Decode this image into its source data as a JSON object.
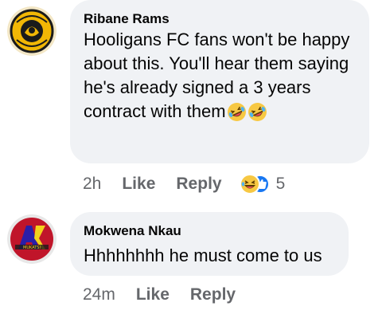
{
  "comments": [
    {
      "author": "Ribane Rams",
      "avatar_badge": "KAIZER CHIEFS",
      "text": "Hooligans FC fans won't be happy about this. You'll hear them saying he's already signed a 3 years contract with them",
      "emojis": [
        "rolling-on-floor-laughing-emoji",
        "rolling-on-floor-laughing-emoji"
      ],
      "time": "2h",
      "like_label": "Like",
      "reply_label": "Reply",
      "reactions": [
        "haha-reaction-icon",
        "like-reaction-icon"
      ],
      "reaction_count": "5"
    },
    {
      "author": "Mokwena Nkau",
      "text": "Hhhhhhhh he must come to us",
      "time": "24m",
      "like_label": "Like",
      "reply_label": "Reply"
    }
  ],
  "colors": {
    "bubble": "#f0f2f5",
    "meta_text": "#65676b",
    "like_blue": "#1877f2",
    "emoji_yellow": "#f7c843"
  }
}
